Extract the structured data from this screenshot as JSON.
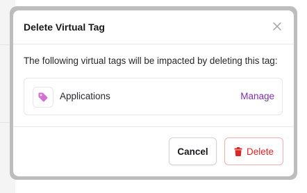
{
  "modal": {
    "title": "Delete Virtual Tag",
    "description": "The following virtual tags will be impacted by deleting this tag:",
    "tags": [
      {
        "name": "Applications",
        "icon": "tag-icon",
        "action_label": "Manage"
      }
    ],
    "buttons": {
      "cancel_label": "Cancel",
      "delete_label": "Delete"
    }
  },
  "colors": {
    "accent": "#7c2fb0",
    "danger": "#dc2626",
    "tag_icon": "#d46fd4"
  },
  "icons": [
    "close-icon",
    "tag-icon",
    "trash-icon"
  ]
}
